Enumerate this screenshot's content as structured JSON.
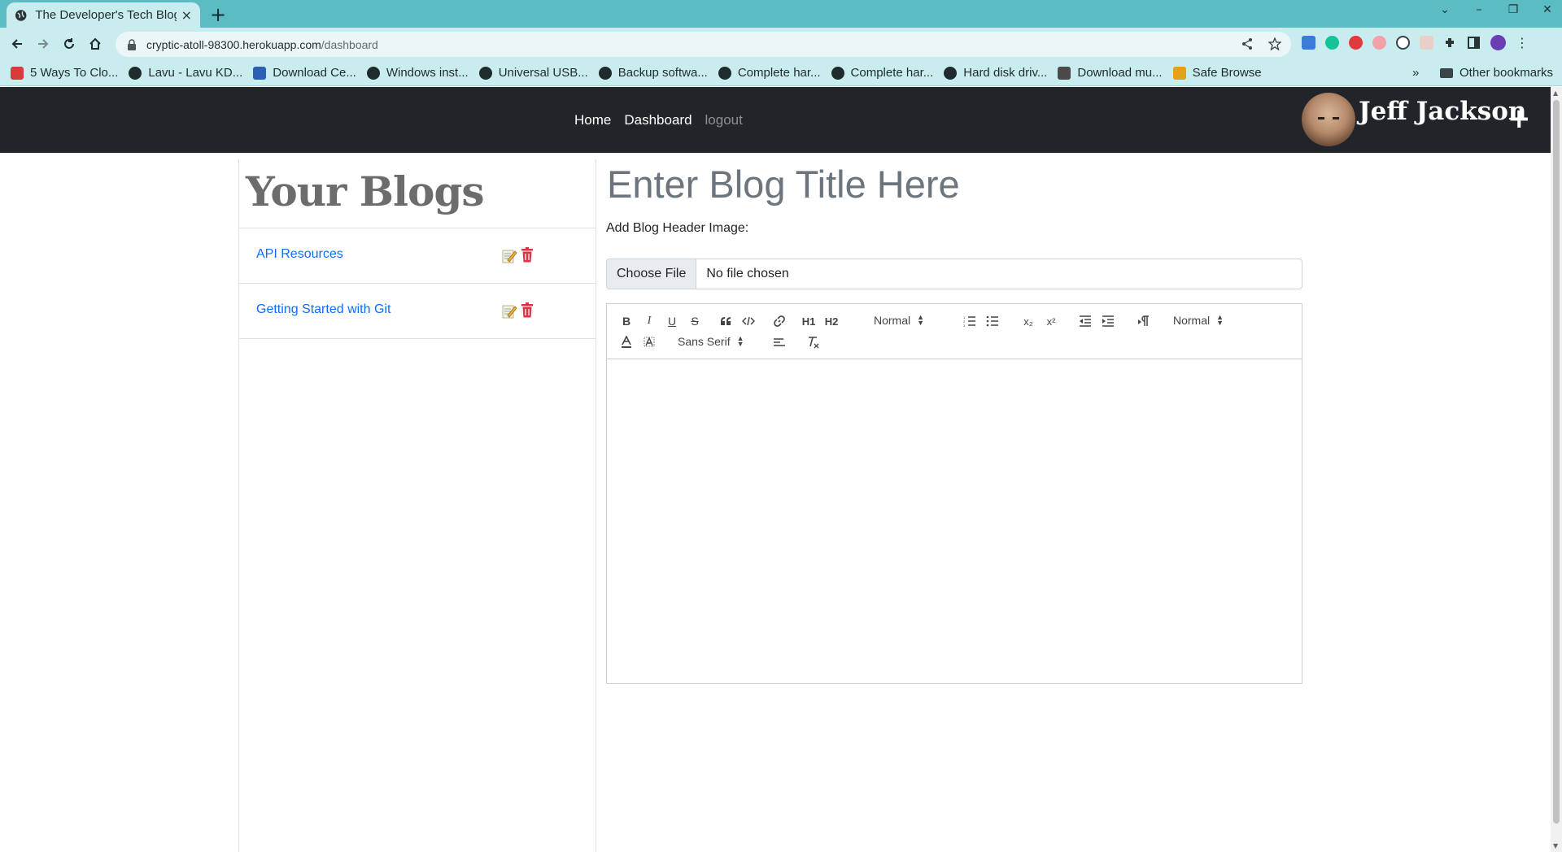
{
  "browser": {
    "tab_title": "The Developer's Tech Blog",
    "tab_close": "×",
    "new_tab": "+",
    "url_host": "cryptic-atoll-98300.herokuapp.com",
    "url_path": "/dashboard",
    "bookmarks": [
      {
        "label": "5 Ways To Clo...",
        "color": "#d83b3b"
      },
      {
        "label": "Lavu - Lavu KD...",
        "color": "#1f2b2d"
      },
      {
        "label": "Download Ce...",
        "color": "#2b5fb5"
      },
      {
        "label": "Windows inst...",
        "color": "#1f2b2d"
      },
      {
        "label": "Universal USB...",
        "color": "#1f2b2d"
      },
      {
        "label": "Backup softwa...",
        "color": "#1f2b2d"
      },
      {
        "label": "Complete har...",
        "color": "#1f2b2d"
      },
      {
        "label": "Complete har...",
        "color": "#1f2b2d"
      },
      {
        "label": "Hard disk driv...",
        "color": "#1f2b2d"
      },
      {
        "label": "Download mu...",
        "color": "#4a4a4a"
      },
      {
        "label": "Safe Browse",
        "color": "#e3a21a"
      }
    ],
    "bookmarks_more": "»",
    "other_bookmarks": "Other bookmarks"
  },
  "site_nav": {
    "links": [
      "Home",
      "Dashboard",
      "logout"
    ],
    "user_name": "Jeff Jackson",
    "add_label": "+"
  },
  "blogs": {
    "heading": "Your Blogs",
    "items": [
      {
        "title": "API Resources"
      },
      {
        "title": "Getting Started with Git"
      }
    ]
  },
  "editor": {
    "title_placeholder": "Enter Blog Title Here",
    "header_image_label": "Add Blog Header Image:",
    "choose_file": "Choose File",
    "file_status": "No file chosen",
    "toolbar": {
      "bold": "B",
      "italic": "I",
      "underline": "U",
      "strike": "S",
      "h1": "H1",
      "h2": "H2",
      "size_select": "Normal",
      "sub": "x₂",
      "sup": "x²",
      "header_select": "Normal",
      "font_select": "Sans Serif"
    }
  },
  "colors": {
    "accent_link": "#0d6efd",
    "navbar_bg": "#212529",
    "trash_red": "#dc3545",
    "tab_strip": "#5bbcc4"
  }
}
